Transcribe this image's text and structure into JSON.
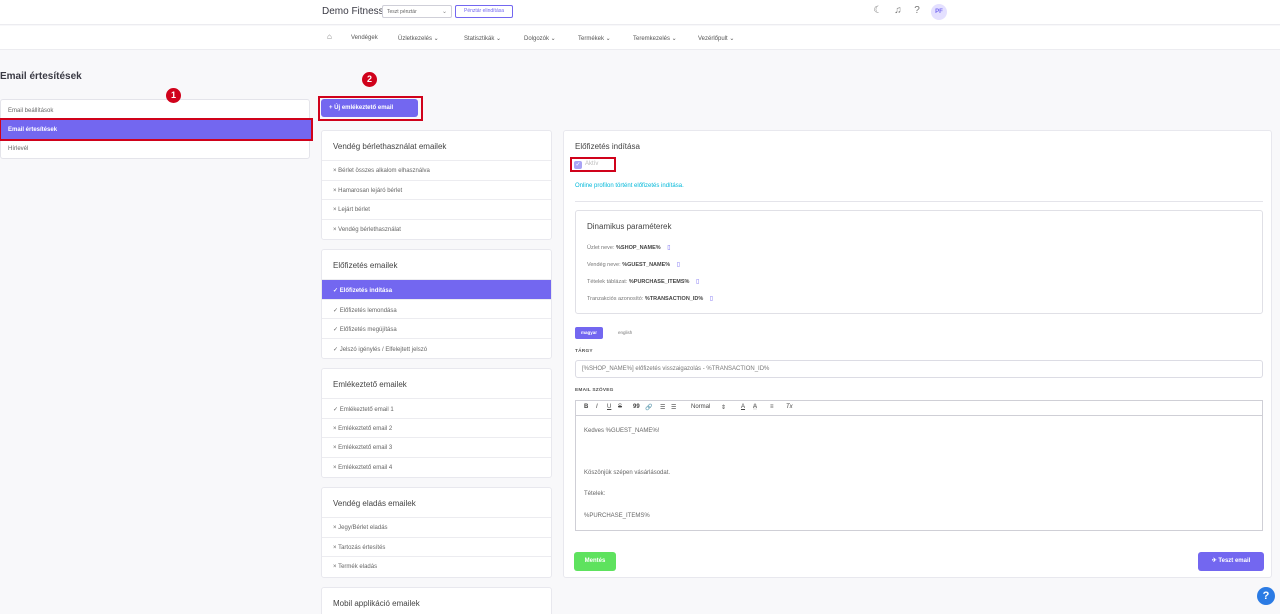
{
  "topbar": {
    "brand": "Demo Fitness",
    "shop_select": "Teszt pénztár",
    "cash_button": "Pénztár elindítása",
    "icons": [
      "moon-icon",
      "bell-icon",
      "help-icon"
    ],
    "avatar": "PF"
  },
  "nav": {
    "items": [
      "Vendégek",
      "Üzletkezelés ⌄",
      "Statisztikák ⌄",
      "Dolgozók ⌄",
      "Termékek ⌄",
      "Teremkezelés ⌄",
      "Vezérlőpult ⌄"
    ]
  },
  "page_title": "Email értesítések",
  "sidebar": {
    "items": [
      "Email beállítások",
      "Email értesítések",
      "Hírlevél"
    ],
    "active_index": 1
  },
  "badges": [
    "1",
    "2"
  ],
  "new_reminder_button": "+ Új emlékeztető email",
  "groups": [
    {
      "title": "Vendég bérlethasználat emailek",
      "items": [
        "× Bérlet összes alkalom elhasználva",
        "× Hamarosan lejáró bérlet",
        "× Lejárt bérlet",
        "× Vendég bérlethasználat"
      ]
    },
    {
      "title": "Előfizetés emailek",
      "items": [
        "✓ Előfizetés indítása",
        "✓ Előfizetés lemondása",
        "✓ Előfizetés megújítása",
        "✓ Jelszó igénylés / Elfelejtett jelszó"
      ],
      "active_index": 0
    },
    {
      "title": "Emlékeztető emailek",
      "items": [
        "✓ Emlékeztető email 1",
        "× Emlékeztető email 2",
        "× Emlékeztető email 3",
        "× Emlékeztető email 4"
      ]
    },
    {
      "title": "Vendég eladás emailek",
      "items": [
        "× Jegy/Bérlet eladás",
        "× Tartozás értesítés",
        "× Termék eladás"
      ]
    },
    {
      "title": "Mobil applikáció emailek",
      "items": []
    }
  ],
  "panel": {
    "title": "Előfizetés indítása",
    "active_label": "Aktív",
    "active_checked": true,
    "description": "Online profilon történt előfizetés indítása.",
    "dynamic": {
      "title": "Dinamikus paraméterek",
      "params": [
        {
          "label": "Üzlet neve:",
          "token": "%SHOP_NAME%"
        },
        {
          "label": "Vendég neve:",
          "token": "%GUEST_NAME%"
        },
        {
          "label": "Tételek táblázat:",
          "token": "%PURCHASE_ITEMS%"
        },
        {
          "label": "Tranzakciós azonosító:",
          "token": "%TRANSACTION_ID%"
        }
      ]
    },
    "languages": [
      "magyar",
      "english"
    ],
    "subject_label": "TÁRGY",
    "subject_value": "[%SHOP_NAME%] előfizetés visszaigazolás - %TRANSACTION_ID%",
    "body_label": "EMAIL SZÖVEG",
    "toolbar": {
      "bold": "B",
      "italic": "I",
      "underline": "U",
      "strike": "S",
      "quote": "99",
      "link": "🔗",
      "ol": "☰",
      "ul": "☰",
      "format": "Normal",
      "format_chev": "⇕",
      "color": "A",
      "bg": "A",
      "align": "≡",
      "clear": "Tx"
    },
    "body_lines": [
      "Kedves %GUEST_NAME%!",
      "Köszönjük szépen vásárlásodat.",
      "Tételek:",
      "%PURCHASE_ITEMS%"
    ],
    "save_button": "Mentés",
    "test_button": "✈ Teszt email"
  },
  "help_fab": "?"
}
